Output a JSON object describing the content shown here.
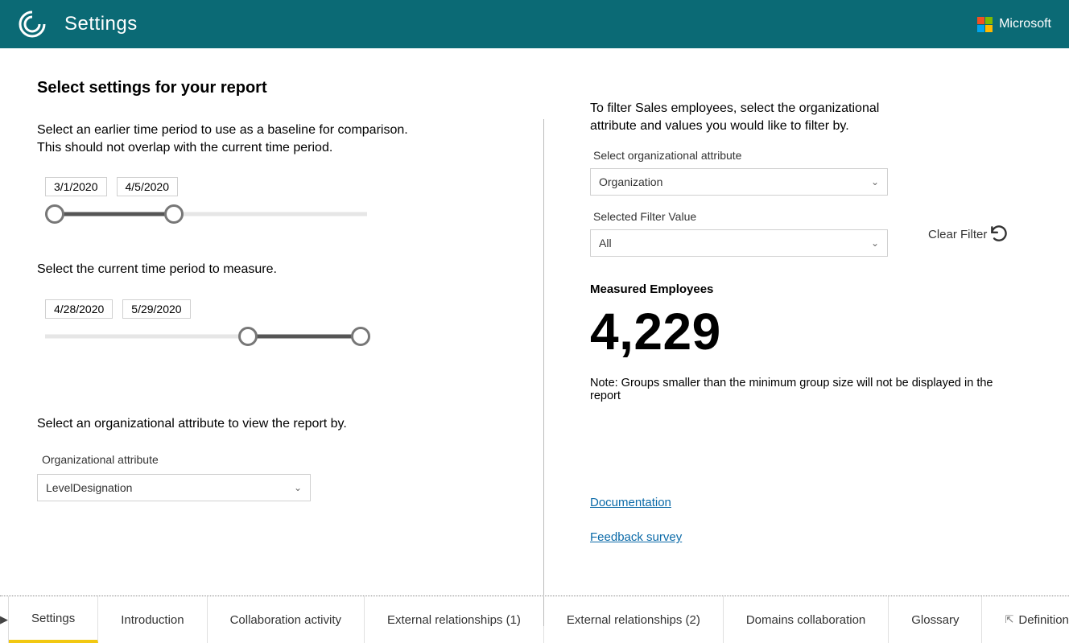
{
  "header": {
    "title": "Settings",
    "brand": "Microsoft"
  },
  "left": {
    "heading": "Select settings for your report",
    "baseline_text_line1": "Select an earlier time period to use as a baseline for comparison.",
    "baseline_text_line2": "This should not overlap with the current time period.",
    "baseline_start": "3/1/2020",
    "baseline_end": "4/5/2020",
    "current_text": "Select the current time period to measure.",
    "current_start": "4/28/2020",
    "current_end": "5/29/2020",
    "org_attr_text": "Select an organizational attribute to view the report by.",
    "org_attr_label": "Organizational attribute",
    "org_attr_value": "LevelDesignation"
  },
  "right": {
    "filter_intro": "To filter Sales employees, select the organizational attribute and values you would like to filter by.",
    "org_attr_label": "Select organizational attribute",
    "org_attr_value": "Organization",
    "filter_value_label": "Selected Filter Value",
    "filter_value_value": "All",
    "clear_filter_label": "Clear Filter",
    "measured_label": "Measured Employees",
    "measured_value": "4,229",
    "note": "Note: Groups smaller than the minimum group size will not be displayed in the report",
    "link_doc": "Documentation",
    "link_survey": "Feedback survey"
  },
  "tabs": [
    "Settings",
    "Introduction",
    "Collaboration activity",
    "External relationships (1)",
    "External relationships (2)",
    "Domains collaboration",
    "Glossary",
    "Definition T"
  ],
  "active_tab_index": 0
}
